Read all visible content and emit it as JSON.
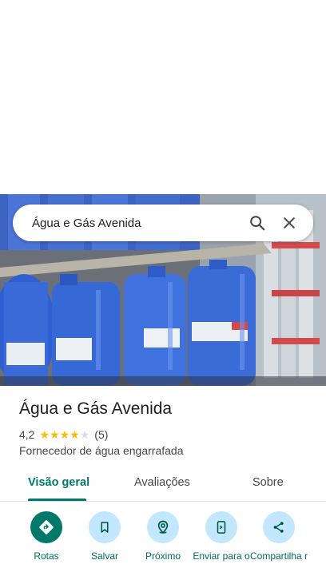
{
  "search": {
    "query": "Água e Gás Avenida"
  },
  "place": {
    "name": "Água e Gás Avenida",
    "rating": "4,2",
    "stars_filled": 4,
    "stars_total": 5,
    "review_count": "(5)",
    "category": "Fornecedor de água engarrafada"
  },
  "tabs": [
    {
      "label": "Visão geral",
      "active": true
    },
    {
      "label": "Avaliações",
      "active": false
    },
    {
      "label": "Sobre",
      "active": false
    }
  ],
  "actions": [
    {
      "label": "Rotas",
      "icon": "directions-icon"
    },
    {
      "label": "Salvar",
      "icon": "bookmark-icon"
    },
    {
      "label": "Próximo",
      "icon": "nearby-icon"
    },
    {
      "label": "Enviar para o",
      "icon": "send-to-phone-icon"
    },
    {
      "label": "Compartilha r",
      "icon": "share-icon"
    }
  ],
  "colors": {
    "accent": "#00796b",
    "action_bg": "#c2e7ff",
    "star": "#fbbc04",
    "star_empty": "#dadce0"
  }
}
